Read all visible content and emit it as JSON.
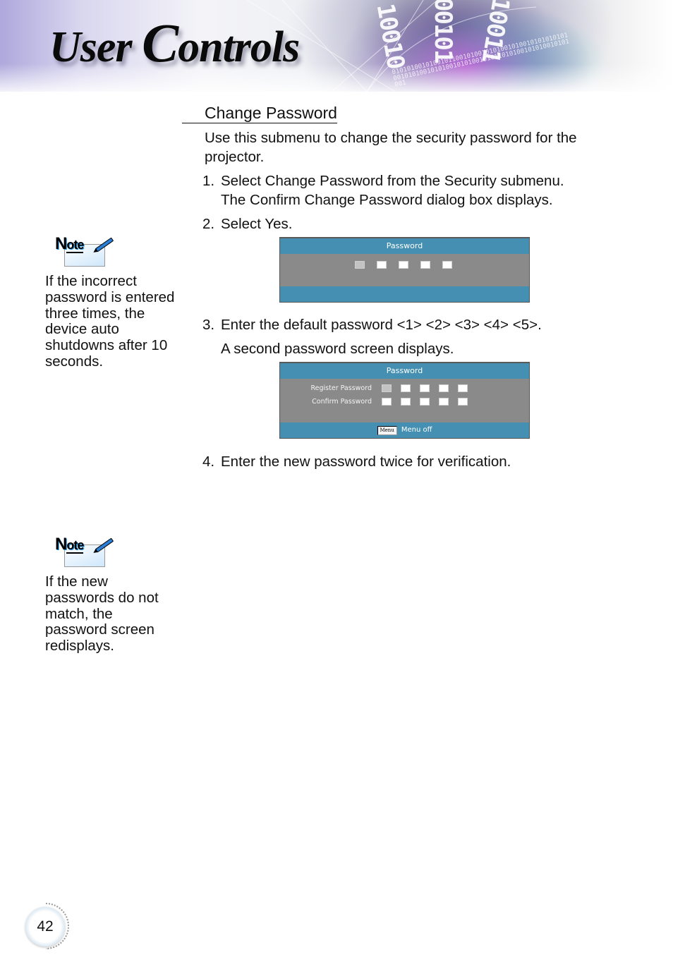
{
  "header": {
    "title_first": "User ",
    "title_cap": "C",
    "title_rest": "ontrols",
    "binary_1": "10010",
    "binary_2": "00101",
    "binary_3": "10011",
    "binary_small": "0101010010100101100101001010100101001010101010100101010010101001010100101011010100101010010101001"
  },
  "section": {
    "title": "Change Password",
    "intro": "Use this submenu to change the security password for the projector.",
    "steps": [
      {
        "num": "1.",
        "text": "Select Change Password from the Security submenu.",
        "cont": "The Confirm Change Password dialog box displays."
      },
      {
        "num": "2.",
        "text": "Select Yes."
      },
      {
        "num": "3.",
        "text": "Enter the default password <1> <2> <3> <4> <5>.",
        "cont": "A second password screen displays."
      },
      {
        "num": "4.",
        "text": "Enter the new password twice for verification."
      }
    ]
  },
  "osd1": {
    "title": "Password",
    "boxes": 5,
    "active_index": 0
  },
  "osd2": {
    "title": "Password",
    "rows": [
      {
        "label": "Register Password"
      },
      {
        "label": "Confirm Password"
      }
    ],
    "menu_key": "Menu",
    "footer": "Menu off"
  },
  "notes": [
    {
      "label": "Note",
      "text": "If the incorrect password is entered three times, the device auto shutdowns after 10 seconds."
    },
    {
      "label": "Note",
      "text": "If the new passwords do not match, the password screen redisplays."
    }
  ],
  "page_number": "42"
}
